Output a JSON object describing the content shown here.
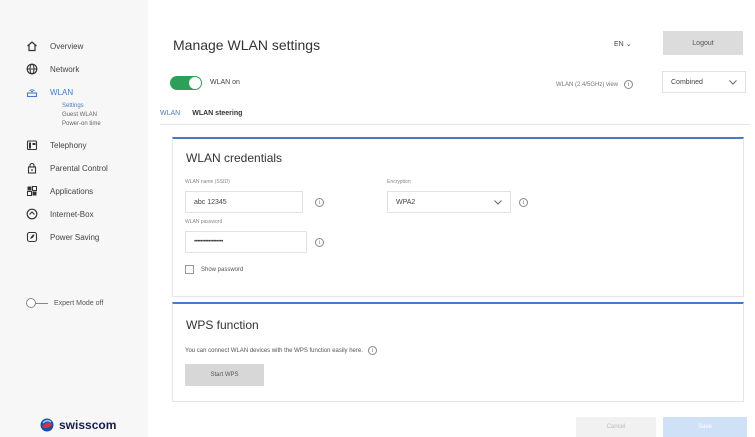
{
  "sidebar": {
    "items": [
      {
        "label": "Overview",
        "icon": "home-icon"
      },
      {
        "label": "Network",
        "icon": "globe-icon"
      },
      {
        "label": "WLAN",
        "icon": "wlan-icon",
        "active": true
      },
      {
        "label": "Telephony",
        "icon": "phone-icon"
      },
      {
        "label": "Parental Control",
        "icon": "lock-icon"
      },
      {
        "label": "Applications",
        "icon": "apps-icon"
      },
      {
        "label": "Internet-Box",
        "icon": "box-icon"
      },
      {
        "label": "Power Saving",
        "icon": "power-icon"
      }
    ],
    "subitems": [
      "Settings",
      "Guest WLAN",
      "Power-on time"
    ],
    "expert_mode": "Expert Mode off",
    "brand": "swisscom"
  },
  "header": {
    "title": "Manage WLAN settings",
    "lang": "EN",
    "logout": "Logout"
  },
  "wlan": {
    "toggle_label": "WLAN on",
    "view_label": "WLAN (2.4/5GHz) view",
    "view_value": "Combined"
  },
  "tabs": [
    "WLAN",
    "WLAN steering"
  ],
  "credentials": {
    "title": "WLAN credentials",
    "name_label": "WLAN name (SSID)",
    "name_value": "abc 12345",
    "encryption_label": "Encryption",
    "encryption_value": "WPA2",
    "password_label": "WLAN password",
    "password_value": "••••••••••••••••••",
    "show_password": "Show password"
  },
  "wps": {
    "title": "WPS function",
    "description": "You can connect WLAN devices with the WPS function easily here.",
    "button": "Start WPS"
  },
  "footer": {
    "cancel": "Cancel",
    "save": "Save"
  },
  "colors": {
    "accent": "#4a79c9",
    "toggle_on": "#2e9f5a"
  }
}
